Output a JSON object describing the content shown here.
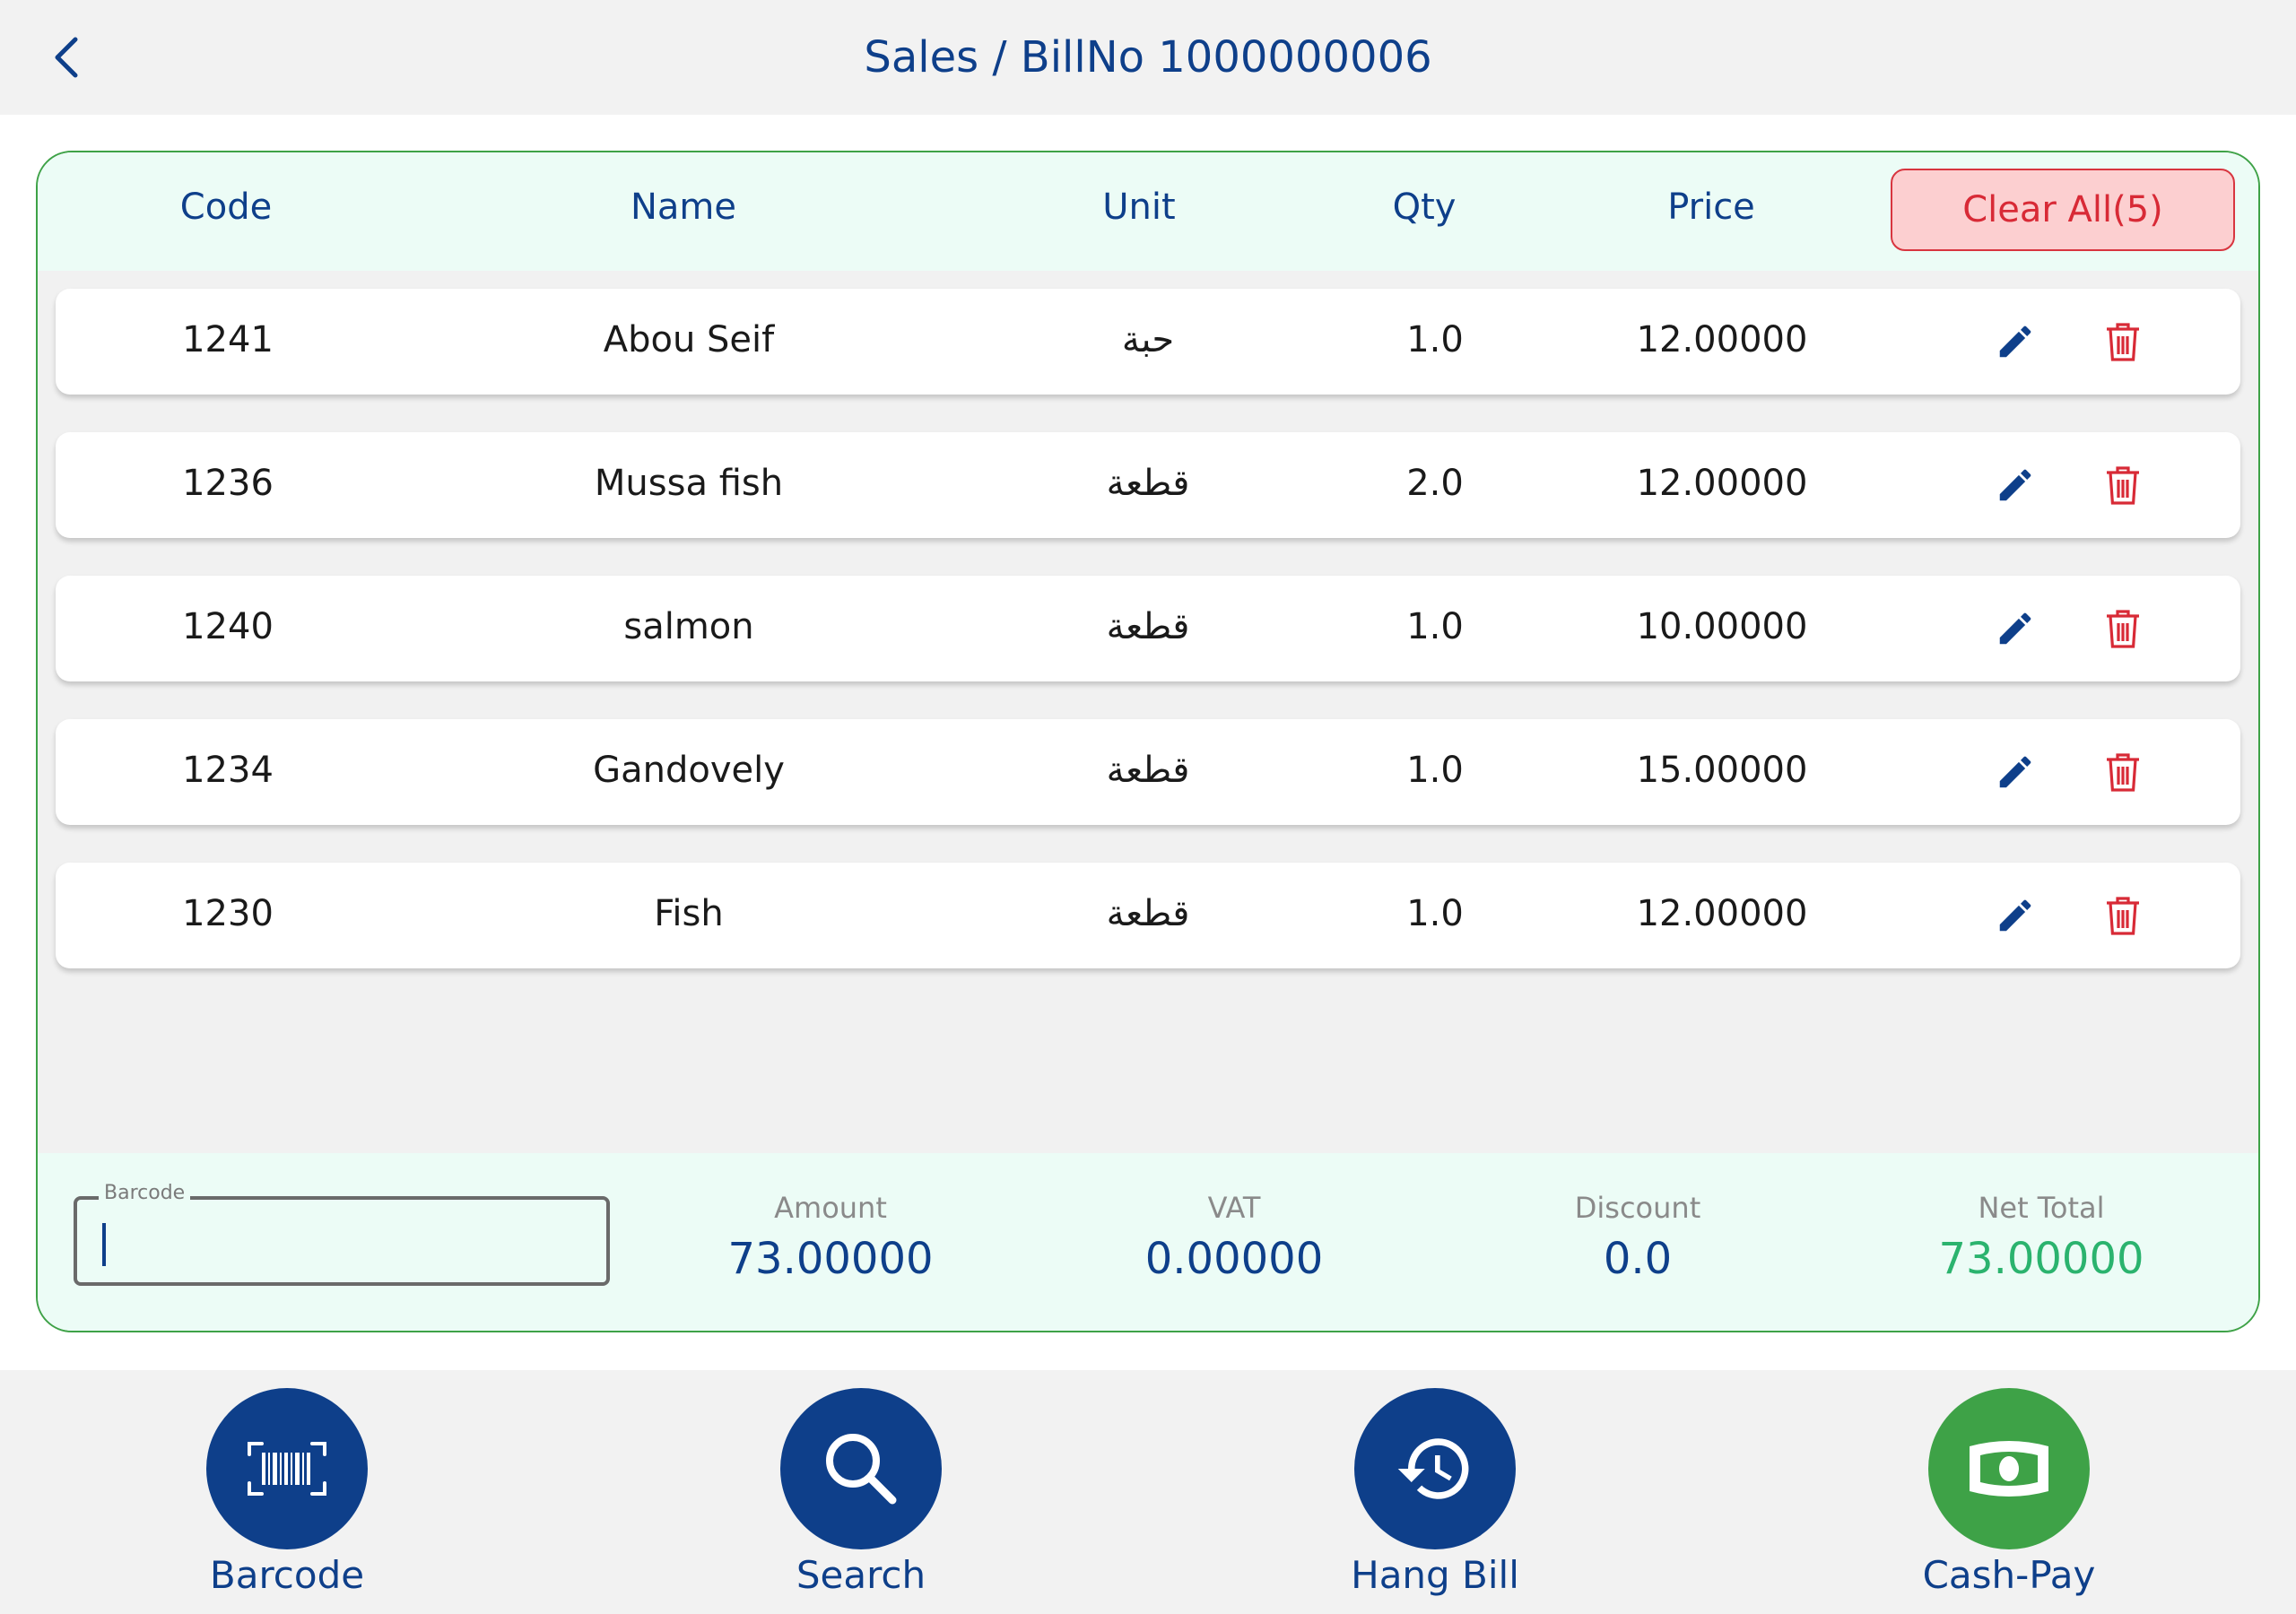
{
  "header": {
    "title": "Sales / BillNo 1000000006"
  },
  "table": {
    "columns": {
      "code": "Code",
      "name": "Name",
      "unit": "Unit",
      "qty": "Qty",
      "price": "Price"
    },
    "clear_all_label": "Clear All(5)",
    "rows": [
      {
        "code": "1241",
        "name": "Abou Seif",
        "unit": "حبة",
        "qty": "1.0",
        "price": "12.00000"
      },
      {
        "code": "1236",
        "name": "Mussa fish",
        "unit": "قطعة",
        "qty": "2.0",
        "price": "12.00000"
      },
      {
        "code": "1240",
        "name": "salmon",
        "unit": "قطعة",
        "qty": "1.0",
        "price": "10.00000"
      },
      {
        "code": "1234",
        "name": "Gandovely",
        "unit": "قطعة",
        "qty": "1.0",
        "price": "15.00000"
      },
      {
        "code": "1230",
        "name": "Fish",
        "unit": "قطعة",
        "qty": "1.0",
        "price": "12.00000"
      }
    ]
  },
  "summary": {
    "barcode_label": "Barcode",
    "barcode_value": "",
    "amount_label": "Amount",
    "amount": "73.00000",
    "vat_label": "VAT",
    "vat": "0.00000",
    "discount_label": "Discount",
    "discount": "0.0",
    "net_total_label": "Net Total",
    "net_total": "73.00000"
  },
  "actions": {
    "barcode": "Barcode",
    "search": "Search",
    "hang_bill": "Hang Bill",
    "cash_pay": "Cash-Pay"
  },
  "colors": {
    "primary": "#0e3f8a",
    "accent_green": "#3ea247",
    "danger": "#d82a36",
    "net_total": "#2bb36e"
  },
  "icons": {
    "back": "chevron-left-icon",
    "edit": "pencil-icon",
    "delete": "trash-icon",
    "barcode": "barcode-scan-icon",
    "search": "magnifier-icon",
    "hang_bill": "history-icon",
    "cash_pay": "banknote-icon"
  }
}
